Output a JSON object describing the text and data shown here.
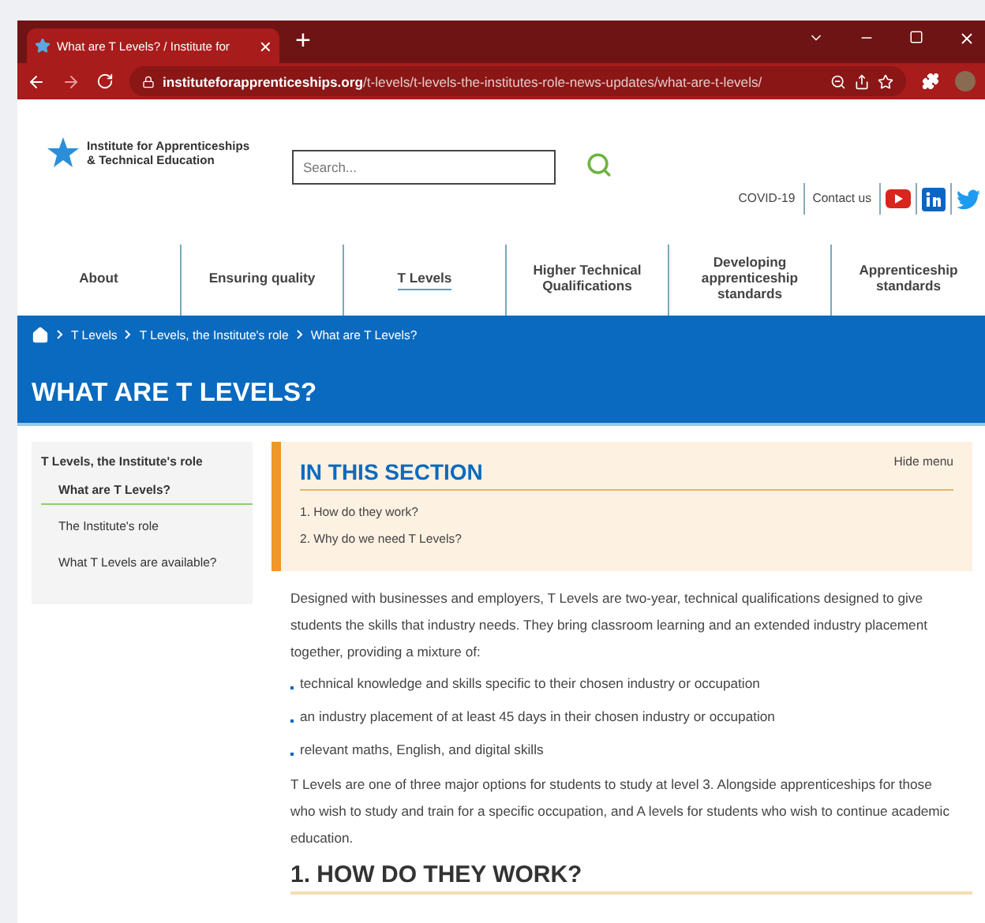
{
  "browser": {
    "tab_title": "What are T Levels? / Institute for",
    "tab_close": "×",
    "new_tab": "+",
    "url_domain": "instituteforapprenticeships.org",
    "url_path": "/t-levels/t-levels-the-institutes-role-news-updates/what-are-t-levels/"
  },
  "header": {
    "logo_lines": [
      "Institute for Apprenticeships",
      "& Technical Education"
    ],
    "search": {
      "placeholder": "Search..."
    },
    "links": [
      "COVID-19",
      "Contact us"
    ]
  },
  "nav": [
    {
      "label": "About",
      "selected": false
    },
    {
      "label": "Ensuring quality",
      "selected": false
    },
    {
      "label": "T Levels",
      "selected": true
    },
    {
      "label": "Higher Technical Qualifications",
      "selected": false
    },
    {
      "label": "Developing apprenticeship standards",
      "selected": false
    },
    {
      "label": "Apprenticeship standards",
      "selected": false
    }
  ],
  "breadcrumb": [
    "T Levels",
    "T Levels, the Institute's role",
    "What are T Levels?"
  ],
  "page_title": "WHAT ARE T LEVELS?",
  "sidebar": {
    "heading": "T Levels, the Institute's role",
    "items": [
      {
        "label": "What are T Levels?",
        "selected": true
      },
      {
        "label": "The Institute's role",
        "selected": false
      },
      {
        "label": "What T Levels are available?",
        "selected": false
      }
    ]
  },
  "in_this_section": {
    "title": "IN THIS SECTION",
    "hide": "Hide menu",
    "items": [
      "1. How do they work?",
      "2. Why do we need T Levels?"
    ]
  },
  "intro": "Designed with businesses and employers, T Levels are two-year, technical qualifications designed to give students the skills that industry needs. They bring classroom learning and an extended industry placement together, providing a mixture of:",
  "bullets": [
    "technical knowledge and skills specific to their chosen industry or occupation",
    "an industry placement of at least 45 days in their chosen industry or occupation",
    "relevant maths, English, and digital skills"
  ],
  "outro": "T Levels are one of three major options for students to study at level 3. Alongside apprenticeships for those who wish to study and train for a specific occupation, and A levels for students who wish to continue academic education.",
  "section_heading": "1. HOW DO THEY WORK?"
}
